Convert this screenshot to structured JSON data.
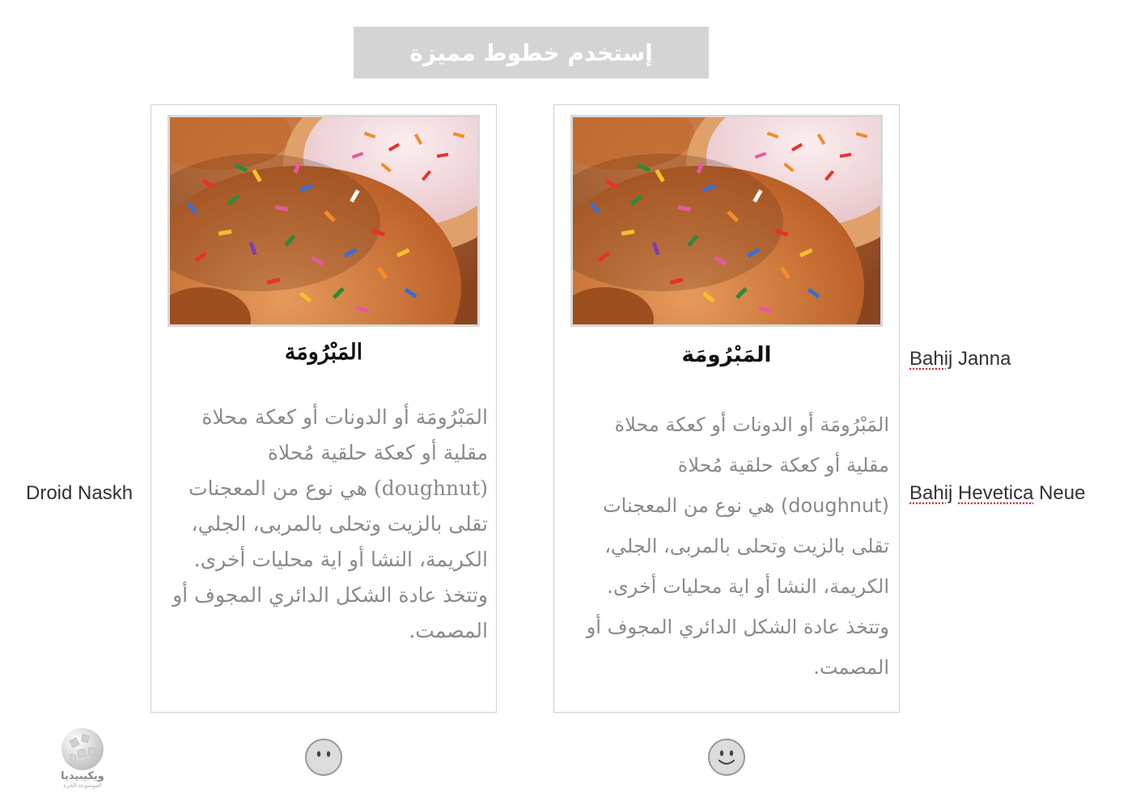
{
  "banner": {
    "label": "إستخدم خطوط مميزة"
  },
  "cards": [
    {
      "title": "المَبْرُومَة",
      "body": "المَبْرُومَة أو الدونات أو كعكة محلاة مقلية أو كعكة حلقية مُحلاة (doughnut) هي نوع من المعجنات تقلى بالزيت وتحلى بالمربى، الجلي، الكريمة، النشا أو اية محليات أخرى. وتتخذ عادة الشكل الدائري المجوف أو المصمت."
    },
    {
      "title": "المَبْرُومَة",
      "body": "المَبْرُومَة أو الدونات أو كعكة محلاة مقلية أو كعكة حلقية مُحلاة (doughnut) هي نوع من المعجنات تقلى بالزيت وتحلى بالمربى، الجلي، الكريمة، النشا أو اية محليات أخرى. وتتخذ عادة الشكل الدائري المجوف أو المصمت."
    }
  ],
  "font_labels": {
    "left": "Droid Naskh",
    "right_top": {
      "first": "Bahij",
      "second": "Janna"
    },
    "right_bottom": {
      "first": "Bahij",
      "second": "Hevetica",
      "third": "Neue"
    }
  },
  "icons": {
    "face_left": "neutral-face-icon",
    "face_right": "smiling-face-icon",
    "logo": "wikipedia-globe-icon"
  },
  "logo": {
    "text": "ويكيبيديا",
    "subtext": "الموسوعة الحرة"
  },
  "colors": {
    "banner_bg": "#d4d4d4",
    "body_text": "#8a8a8a",
    "card_border": "#d0d0d0",
    "face_fill": "#dcdcdc"
  }
}
